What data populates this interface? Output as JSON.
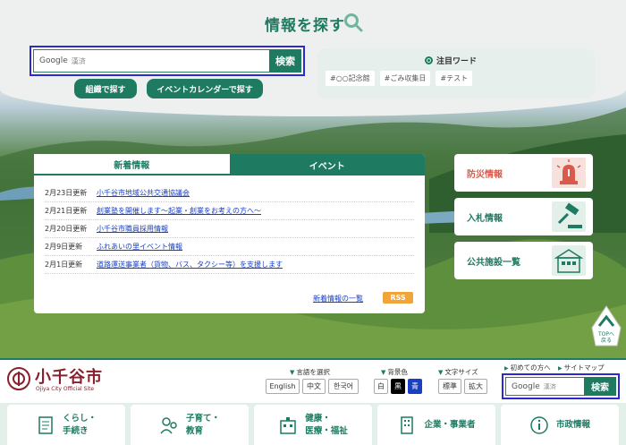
{
  "search_section": {
    "title": "情報を探す",
    "input_brand": "Google",
    "input_placeholder": "漢済",
    "button": "検索",
    "btn_org": "組織で探す",
    "btn_event": "イベントカレンダーで探す"
  },
  "keywords": {
    "heading": "注目ワード",
    "tags": [
      "#○○記念館",
      "#ごみ収集日",
      "#テスト"
    ]
  },
  "news": {
    "tabs": [
      {
        "label": "新着情報",
        "active": true
      },
      {
        "label": "イベント",
        "active": false
      }
    ],
    "items": [
      {
        "date": "2月23日更新",
        "title": "小千谷市地域公共交通協議会"
      },
      {
        "date": "2月21日更新",
        "title": "創業塾を開催します〜起業・創業をお考えの方へ〜"
      },
      {
        "date": "2月20日更新",
        "title": "小千谷市職員採用情報"
      },
      {
        "date": "2月9日更新",
        "title": "ふれあいの里イベント情報"
      },
      {
        "date": "2月1日更新",
        "title": "道路運送事業者（貨物、バス、タクシー等）を支援します"
      }
    ],
    "more": "新着情報の一覧",
    "rss": "RSS"
  },
  "side_cards": {
    "disaster": "防災情報",
    "bid": "入札情報",
    "facility": "公共施設一覧"
  },
  "totop": {
    "line1": "TOPへ",
    "line2": "戻る"
  },
  "header": {
    "logo_name": "小千谷市",
    "logo_sub": "Ojiya City Official Site",
    "lang_label": "言語を選択",
    "lang": [
      "English",
      "中文",
      "한국어"
    ],
    "bg_label": "背景色",
    "bg": [
      "白",
      "黒",
      "青"
    ],
    "size_label": "文字サイズ",
    "size": [
      "標準",
      "拡大"
    ],
    "first_visit": "初めての方へ",
    "sitemap": "サイトマップ",
    "search_brand": "Google",
    "search_placeholder": "漢済",
    "search_button": "検索"
  },
  "nav": {
    "life1": "くらし・",
    "life2": "手続き",
    "child1": "子育て・",
    "child2": "教育",
    "health1": "健康・",
    "health2": "医療・福祉",
    "business": "企業・事業者",
    "admin": "市政情報"
  },
  "colors": {
    "accent": "#1f7a62",
    "brand": "#8a1f2d",
    "link": "#1a3fc0",
    "focus": "#2a2ad0",
    "alert": "#d95a4a"
  }
}
